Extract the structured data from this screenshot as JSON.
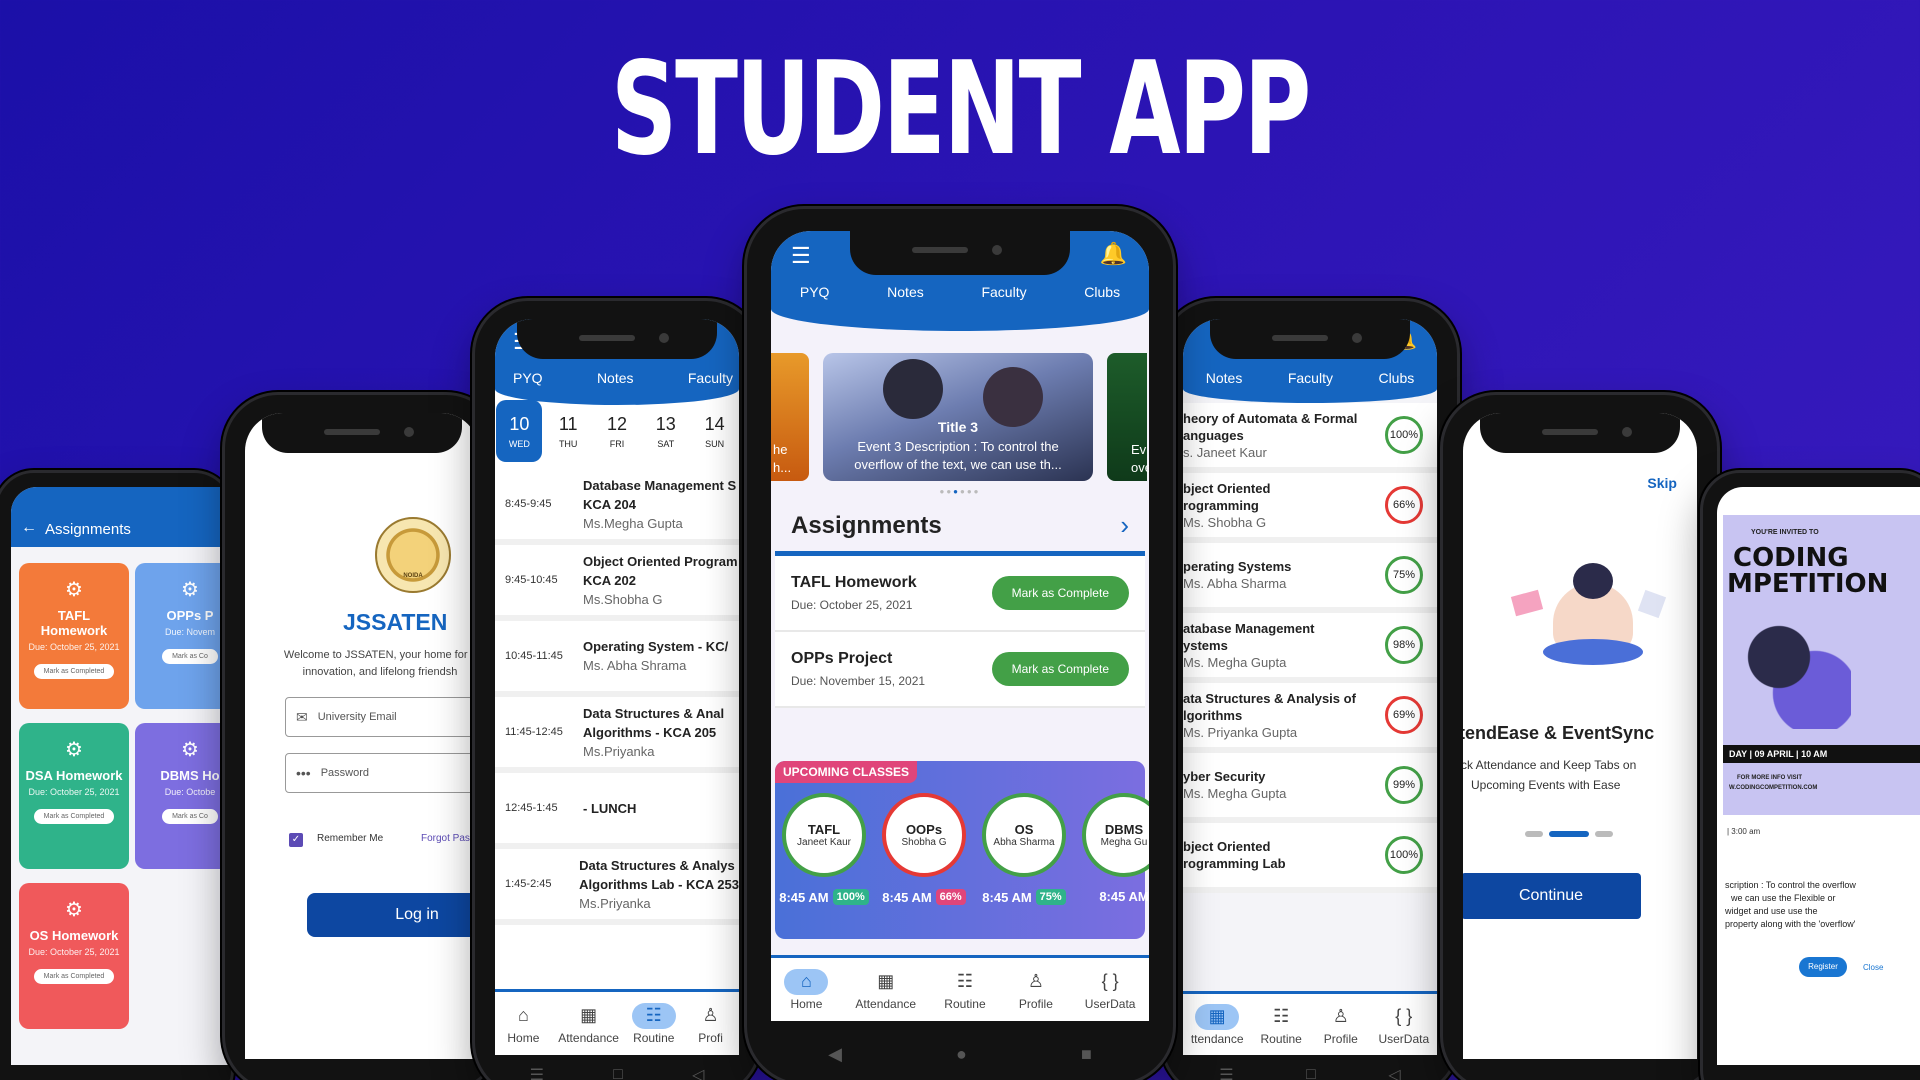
{
  "headline": "STUDENT APP",
  "phone1": {
    "title": "Assignments",
    "cards": [
      {
        "title": "TAFL Homework",
        "due": "Due: October 25, 2021",
        "btn": "Mark as Completed",
        "color": "#f37a3a"
      },
      {
        "title": "OPPs P",
        "due": "Due: Novem",
        "btn": "Mark as Co",
        "color": "#6ea3ec"
      },
      {
        "title": "DSA Homework",
        "due": "Due: October 25, 2021",
        "btn": "Mark as Completed",
        "color": "#2fb38a"
      },
      {
        "title": "DBMS Ho",
        "due": "Due: Octobe",
        "btn": "Mark as Co",
        "color": "#7d6ee0"
      },
      {
        "title": "OS Homework",
        "due": "Due: October 25, 2021",
        "btn": "Mark as Completed",
        "color": "#f0595b"
      }
    ]
  },
  "phone2": {
    "brand": "JSSATEN",
    "welcome": "Welcome to JSSATEN, your home for c innovation, and lifelong friendsh",
    "email_ph": "University Email",
    "password_ph": "Password",
    "remember": "Remember Me",
    "forgot": "Forgot Pass",
    "login": "Log in",
    "seal_text": "NOIDA"
  },
  "phone3": {
    "tabs": [
      "PYQ",
      "Notes",
      "Faculty"
    ],
    "dates": [
      {
        "d": "10",
        "w": "WED"
      },
      {
        "d": "11",
        "w": "THU"
      },
      {
        "d": "12",
        "w": "FRI"
      },
      {
        "d": "13",
        "w": "SAT"
      },
      {
        "d": "14",
        "w": "SUN"
      }
    ],
    "routine": [
      {
        "time": "8:45-9:45",
        "l1": "Database Management S",
        "l2": "KCA 204",
        "prof": "Ms.Megha Gupta"
      },
      {
        "time": "9:45-10:45",
        "l1": "Object Oriented Program",
        "l2": "KCA 202",
        "prof": "Ms.Shobha G"
      },
      {
        "time": "10:45-11:45",
        "l1": "Operating System - KC/",
        "l2": "",
        "prof": "Ms. Abha Shrama"
      },
      {
        "time": "11:45-12:45",
        "l1": "Data Structures &  Anal",
        "l2": "Algorithms - KCA 205",
        "prof": "Ms.Priyanka"
      },
      {
        "time": "12:45-1:45",
        "l1": "- LUNCH",
        "l2": "",
        "prof": ""
      },
      {
        "time": "1:45-2:45",
        "l1": "Data Structures &  Analys",
        "l2": "Algorithms Lab - KCA 253",
        "prof": "Ms.Priyanka"
      }
    ],
    "nav": [
      "Home",
      "Attendance",
      "Routine",
      "Profi"
    ]
  },
  "phone4": {
    "tabs": [
      "PYQ",
      "Notes",
      "Faculty",
      "Clubs"
    ],
    "banner": {
      "title": "Title 3",
      "desc1": "Event 3 Description : To control the",
      "desc2": "overflow of the text, we can use th...",
      "left1": "he",
      "left2": "h...",
      "right1": "Ev",
      "right2": "ove"
    },
    "assign_title": "Assignments",
    "assignments": [
      {
        "title": "TAFL Homework",
        "due": "Due: October 25, 2021",
        "btn": "Mark as Complete"
      },
      {
        "title": "OPPs Project",
        "due": "Due: November 15, 2021",
        "btn": "Mark as Complete"
      }
    ],
    "upcoming": "UPCOMING CLASSES",
    "classes": [
      {
        "name": "TAFL",
        "prof": "Janeet Kaur",
        "time": "8:45 AM",
        "pct": "100%",
        "pc": "#2fb38a"
      },
      {
        "name": "OOPs",
        "prof": "Shobha G",
        "time": "8:45 AM",
        "pct": "66%",
        "pc": "#e0457a"
      },
      {
        "name": "OS",
        "prof": "Abha Sharma",
        "time": "8:45 AM",
        "pct": "75%",
        "pc": "#2fb38a"
      },
      {
        "name": "DBMS",
        "prof": "Megha Gu",
        "time": "8:45 AM",
        "pct": "",
        "pc": "#2fb38a"
      }
    ],
    "nav": [
      "Home",
      "Attendance",
      "Routine",
      "Profile",
      "UserData"
    ]
  },
  "phone5": {
    "tabs": [
      "Notes",
      "Faculty",
      "Clubs"
    ],
    "subjects": [
      {
        "l1": "heory of Automata & Formal",
        "l2": "anguages",
        "prof": "s. Janeet Kaur",
        "pct": "100%",
        "ok": true
      },
      {
        "l1": "bject Oriented",
        "l2": "rogramming",
        "prof": "Ms. Shobha G",
        "pct": "66%",
        "ok": false
      },
      {
        "l1": "perating Systems",
        "l2": "",
        "prof": "Ms. Abha Sharma",
        "pct": "75%",
        "ok": true
      },
      {
        "l1": "atabase Management",
        "l2": "ystems",
        "prof": "Ms. Megha Gupta",
        "pct": "98%",
        "ok": true
      },
      {
        "l1": "ata Structures & Analysis of",
        "l2": "lgorithms",
        "prof": "Ms. Priyanka Gupta",
        "pct": "69%",
        "ok": false
      },
      {
        "l1": "yber Security",
        "l2": "",
        "prof": "Ms. Megha Gupta",
        "pct": "99%",
        "ok": true
      },
      {
        "l1": "bject Oriented",
        "l2": "rogramming Lab",
        "prof": "",
        "pct": "100%",
        "ok": true
      }
    ],
    "nav": [
      "ttendance",
      "Routine",
      "Profile",
      "UserData"
    ]
  },
  "phone6": {
    "skip": "Skip",
    "title": "tendEase & EventSync",
    "sub1": "ck Attendance and Keep Tabs on",
    "sub2": "Upcoming Events with Ease",
    "btn": "Continue"
  },
  "phone7": {
    "invited": "YOU'RE INVITED TO",
    "big1": "CODING",
    "big2": "MPETITION",
    "date": "DAY | 09 APRIL | 10 AM",
    "more1": "FOR MORE INFO VISIT",
    "more2": "W.CODINGCOMPETITION.COM",
    "time": "| 3:00 am",
    "d1": "scription : To control the overflow",
    "d2": "we can use the Flexible or",
    "d3": "widget and use use the",
    "d4": "property along with the 'overflow'",
    "register": "Register",
    "close": "Close"
  }
}
